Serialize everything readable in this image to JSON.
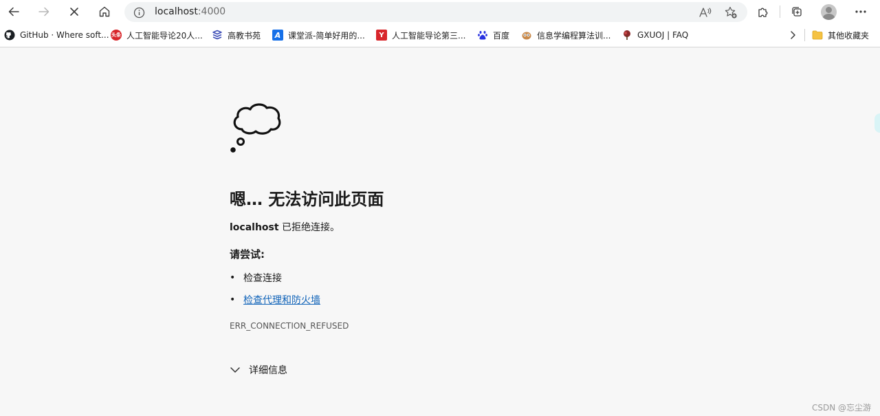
{
  "browser": {
    "url_host": "localhost",
    "url_port": ":4000"
  },
  "bookmarks": [
    {
      "label": "GitHub · Where soft...",
      "icon": "github-icon"
    },
    {
      "label": "人工智能导论20人...",
      "icon": "toutiao-icon",
      "icon_text": "头条"
    },
    {
      "label": "高教书苑",
      "icon": "book-stack-icon"
    },
    {
      "label": "课堂派-简单好用的...",
      "icon": "ketangpai-icon",
      "icon_text": "A"
    },
    {
      "label": "人工智能导论第三...",
      "icon": "red-logo-icon",
      "icon_text": "Y"
    },
    {
      "label": "百度",
      "icon": "baidu-paw-icon"
    },
    {
      "label": "信息学编程算法训...",
      "icon": "owl-icon"
    },
    {
      "label": "GXUOJ | FAQ",
      "icon": "tree-icon"
    }
  ],
  "other_bookmarks": "其他收藏夹",
  "error_page": {
    "title": "嗯… 无法访问此页面",
    "host": "localhost",
    "message": " 已拒绝连接。",
    "try_heading": "请尝试:",
    "suggestions": [
      "检查连接",
      "检查代理和防火墙"
    ],
    "error_code": "ERR_CONNECTION_REFUSED",
    "details_label": "详细信息"
  },
  "watermark": "CSDN @忘尘游",
  "colors": {
    "link": "#0e62b8",
    "page_bg": "#f7f7f7"
  }
}
